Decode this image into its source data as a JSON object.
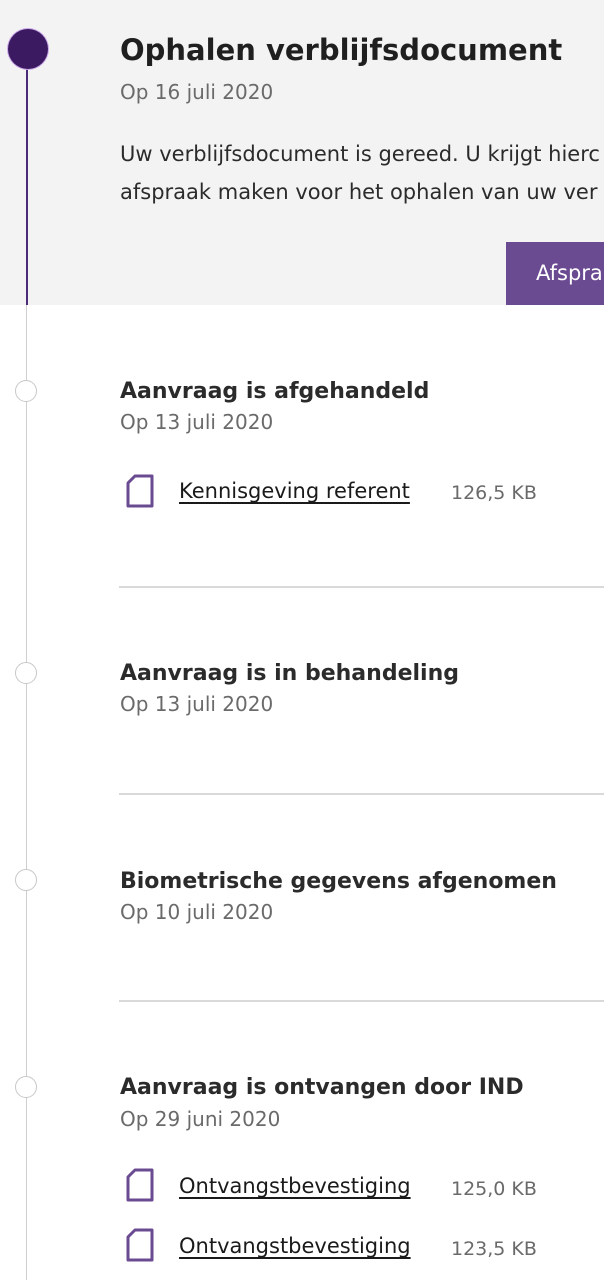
{
  "current": {
    "title": "Ophalen verblijfsdocument",
    "date": "Op 16 juli 2020",
    "text_line1": "Uw verblijfsdocument is gereed. U krijgt hierc",
    "text_line2": "afspraak maken voor het ophalen van uw ver",
    "button_label": "Afspra"
  },
  "items": [
    {
      "title": "Aanvraag is afgehandeld",
      "date": "Op 13 juli 2020",
      "documents": [
        {
          "name": "Kennisgeving referent",
          "size": "126,5 KB",
          "icon": "document-icon"
        }
      ]
    },
    {
      "title": "Aanvraag is in behandeling",
      "date": "Op 13 juli 2020",
      "documents": []
    },
    {
      "title": "Biometrische gegevens afgenomen",
      "date": "Op 10 juli 2020",
      "documents": []
    },
    {
      "title": "Aanvraag is ontvangen door IND",
      "date": "Op 29 juni 2020",
      "documents": [
        {
          "name": "Ontvangstbevestiging",
          "size": "125,0 KB",
          "icon": "document-icon"
        },
        {
          "name": "Ontvangstbevestiging",
          "size": "123,5 KB",
          "icon": "document-icon"
        }
      ]
    }
  ],
  "colors": {
    "accent_purple": "#3b1a62",
    "button_purple": "#6a4a91",
    "current_background": "#f3f3f3",
    "divider": "#d9d9d9"
  }
}
